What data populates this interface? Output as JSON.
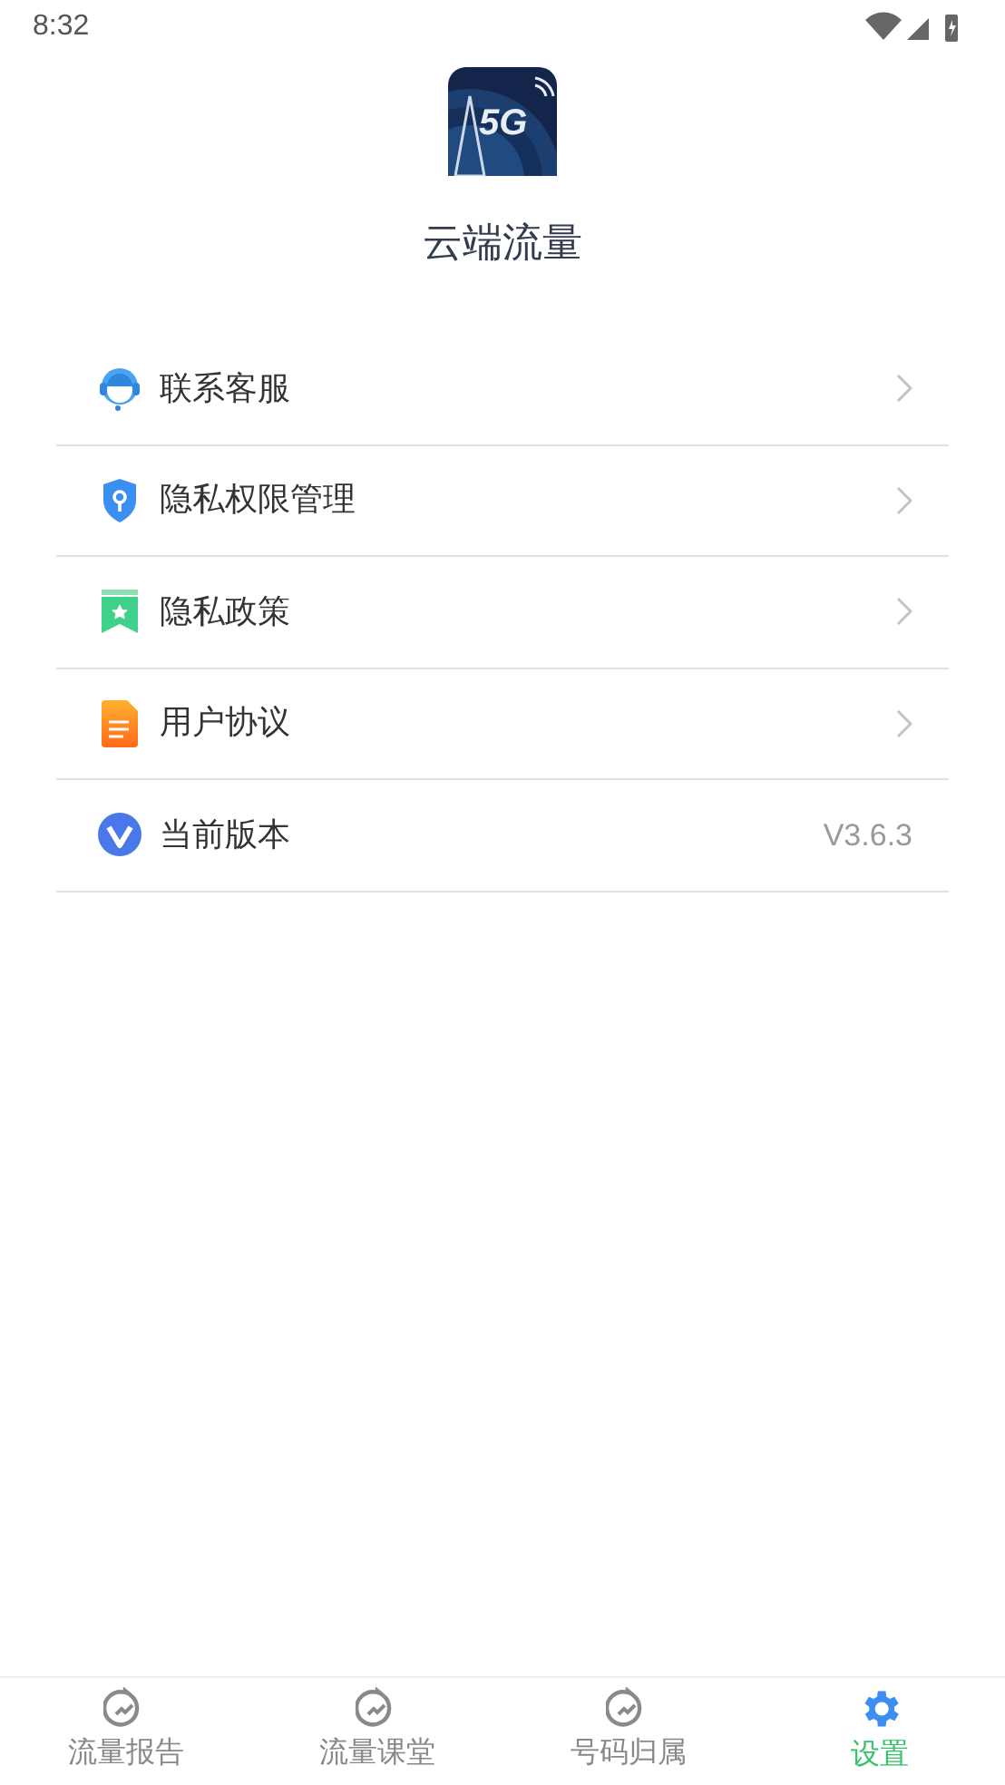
{
  "status_bar": {
    "time": "8:32"
  },
  "app": {
    "logo_text": "5G",
    "name": "云端流量"
  },
  "menu": [
    {
      "label": "联系客服",
      "kind": "link"
    },
    {
      "label": "隐私权限管理",
      "kind": "link"
    },
    {
      "label": "隐私政策",
      "kind": "link"
    },
    {
      "label": "用户协议",
      "kind": "link"
    },
    {
      "label": "当前版本",
      "kind": "value",
      "value": "V3.6.3"
    }
  ],
  "tabs": [
    {
      "label": "流量报告",
      "selected": false
    },
    {
      "label": "流量课堂",
      "selected": false
    },
    {
      "label": "号码归属",
      "selected": false
    },
    {
      "label": "设置",
      "selected": true
    }
  ]
}
